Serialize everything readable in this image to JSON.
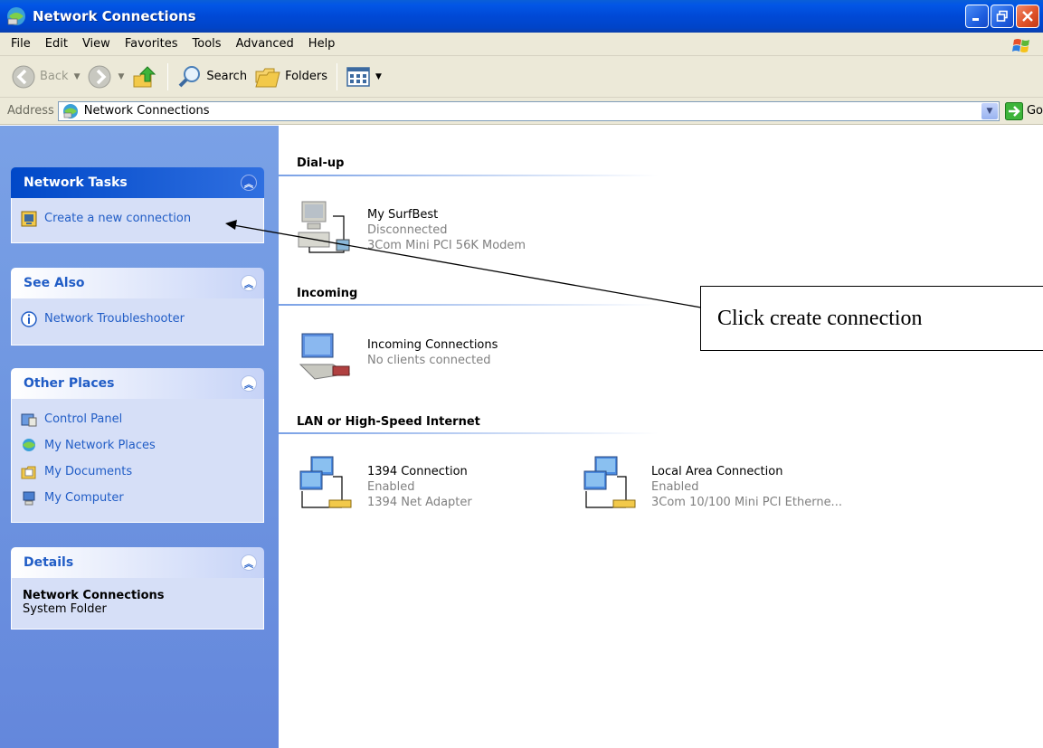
{
  "window": {
    "title": "Network Connections"
  },
  "menu": [
    "File",
    "Edit",
    "View",
    "Favorites",
    "Tools",
    "Advanced",
    "Help"
  ],
  "toolbar": {
    "back_label": "Back",
    "search_label": "Search",
    "folders_label": "Folders"
  },
  "address": {
    "label": "Address",
    "value": "Network Connections",
    "go_label": "Go"
  },
  "panels": {
    "network_tasks": {
      "title": "Network Tasks",
      "items": [
        "Create a new connection"
      ]
    },
    "see_also": {
      "title": "See Also",
      "items": [
        "Network Troubleshooter"
      ]
    },
    "other_places": {
      "title": "Other Places",
      "items": [
        "Control Panel",
        "My Network Places",
        "My Documents",
        "My Computer"
      ]
    },
    "details": {
      "title": "Details",
      "name": "Network Connections",
      "type": "System Folder"
    }
  },
  "groups": {
    "dialup": {
      "title": "Dial-up",
      "connections": [
        {
          "name": "My SurfBest",
          "status": "Disconnected",
          "device": "3Com Mini PCI 56K Modem"
        }
      ]
    },
    "incoming": {
      "title": "Incoming",
      "connections": [
        {
          "name": "Incoming Connections",
          "status": "No clients connected"
        }
      ]
    },
    "lan": {
      "title": "LAN or High-Speed Internet",
      "connections": [
        {
          "name": "1394 Connection",
          "status": "Enabled",
          "device": "1394 Net Adapter"
        },
        {
          "name": "Local Area Connection",
          "status": "Enabled",
          "device": "3Com 10/100 Mini PCI Etherne..."
        }
      ]
    }
  },
  "callout": {
    "text": "Click create connection"
  },
  "colors": {
    "titlebar": "#0049d6",
    "taskpane": "#6e95e0",
    "link": "#215dc6"
  }
}
